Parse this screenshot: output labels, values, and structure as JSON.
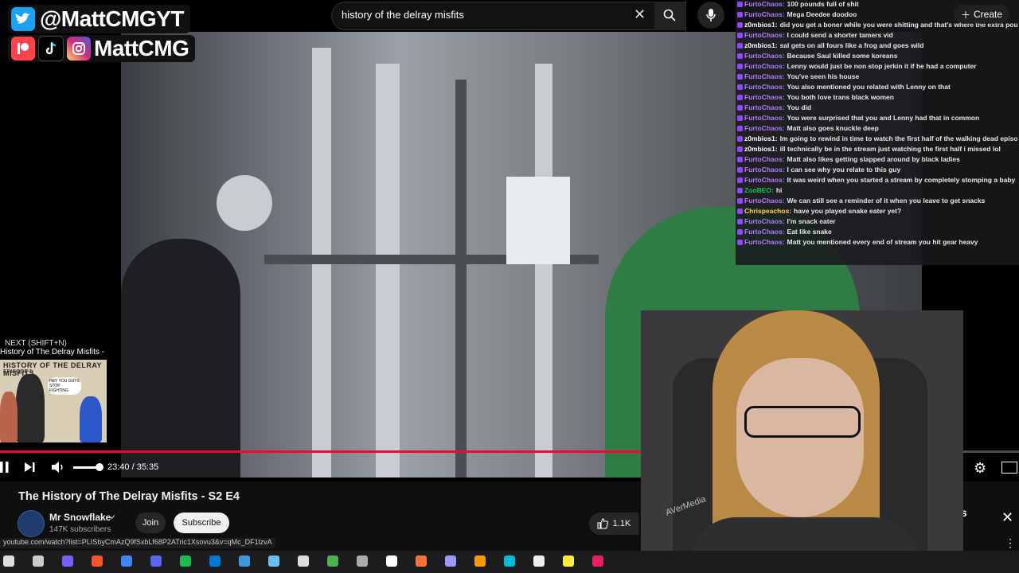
{
  "branding": {
    "twitter_handle": "@MattCMGYT",
    "social_handle": "MattCMG",
    "colors": {
      "twitter": "#1da1f2",
      "patreon": "#ff424d",
      "tiktok": "#000000",
      "instagram": "#d62976"
    }
  },
  "search": {
    "query": "history of the delray misfits"
  },
  "header": {
    "create_label": "Create"
  },
  "chat": [
    {
      "time": "",
      "user": "FurtoChaos",
      "user_color": "#b07bff",
      "text": "100 pounds full of shit"
    },
    {
      "time": "",
      "user": "FurtoChaos",
      "user_color": "#b07bff",
      "text": "Mega Deedee doodoo"
    },
    {
      "time": "",
      "user": "z0mbios1",
      "user_color": "#ffffff",
      "text": "did you get a boner while you were shitting and that's where the extra pounds came from"
    },
    {
      "time": "",
      "user": "FurtoChaos",
      "user_color": "#b07bff",
      "text": "I could send a shorter tamers vid"
    },
    {
      "time": "",
      "user": "z0mbios1",
      "user_color": "#ffffff",
      "text": "sal gets on all fours like a frog and goes wild"
    },
    {
      "time": "",
      "user": "FurtoChaos",
      "user_color": "#b07bff",
      "text": "Because Saul killed some koreans"
    },
    {
      "time": "",
      "user": "FurtoChaos",
      "user_color": "#b07bff",
      "text": "Lenny would just be non stop jerkin it if he had a computer"
    },
    {
      "time": "",
      "user": "FurtoChaos",
      "user_color": "#b07bff",
      "text": "You've seen his house"
    },
    {
      "time": "",
      "user": "FurtoChaos",
      "user_color": "#b07bff",
      "text": "You also mentioned you related with Lenny on that"
    },
    {
      "time": "",
      "user": "FurtoChaos",
      "user_color": "#b07bff",
      "text": "You both love trans black women"
    },
    {
      "time": "",
      "user": "FurtoChaos",
      "user_color": "#b07bff",
      "text": "You did"
    },
    {
      "time": "",
      "user": "FurtoChaos",
      "user_color": "#b07bff",
      "text": "You were surprised that you and Lenny had that in common"
    },
    {
      "time": "",
      "user": "FurtoChaos",
      "user_color": "#b07bff",
      "text": "Matt also goes knuckle deep"
    },
    {
      "time": "",
      "user": "z0mbios1",
      "user_color": "#ffffff",
      "text": "Im going to rewind in time to watch the first half of the walking dead episode, I'll see you in the future"
    },
    {
      "time": "",
      "user": "z0mbios1",
      "user_color": "#ffffff",
      "text": "ill technically be in the stream just watching the first half i missed lol"
    },
    {
      "time": "",
      "user": "FurtoChaos",
      "user_color": "#b07bff",
      "text": "Matt also likes getting slapped around by black ladies"
    },
    {
      "time": "",
      "user": "FurtoChaos",
      "user_color": "#b07bff",
      "text": "I can see why you relate to this guy"
    },
    {
      "time": "",
      "user": "FurtoChaos",
      "user_color": "#b07bff",
      "text": "It was weird when you started a stream by completely stomping a baby into your carpet , but now I understand why you did it"
    },
    {
      "time": "",
      "user": "ZooBEO",
      "user_color": "#00c853",
      "text": "hi"
    },
    {
      "time": "",
      "user": "FurtoChaos",
      "user_color": "#b07bff",
      "text": "We can still see a reminder of it when you leave to get snacks"
    },
    {
      "time": "",
      "user": "Chrispeachos",
      "user_color": "#ffd54f",
      "text": "have you played snake eater yet?"
    },
    {
      "time": "",
      "user": "FurtoChaos",
      "user_color": "#b07bff",
      "text": "I'm snack eater"
    },
    {
      "time": "",
      "user": "FurtoChaos",
      "user_color": "#b07bff",
      "text": "Eat like snake"
    },
    {
      "time": "",
      "user": "FurtoChaos",
      "user_color": "#b07bff",
      "text": "Matt you mentioned every end of stream you hit gear heavy"
    }
  ],
  "next_video": {
    "label": "NEXT (SHIFT+N)",
    "title": "History of The Delray Misfits - Season",
    "thumb_text": "HISTORY OF THE DELRAY MISFITS",
    "thumb_sub": "EPISODE 5",
    "thumb_bubble": "HEY YOU GUYS STOP FIGHTING"
  },
  "player": {
    "time_display": "23:40 / 35:35",
    "progress": 0.665,
    "volume": 0.8,
    "colors": {
      "progress": "#ff0033"
    }
  },
  "video": {
    "title": "The History of The Delray Misfits - S2 E4",
    "channel": "Mr Snowflake",
    "subscribers": "147K subscribers",
    "join_label": "Join",
    "subscribe_label": "Subscribe",
    "likes": "1.1K"
  },
  "status_url": "youtube.com/watch?list=PLISbyCmAzQ9fSxbLf68P2ATric1Xsovu3&v=qMc_DF1lzvA",
  "side_panel": {
    "title_fragment": "isfits"
  },
  "webcam": {
    "brand_text": "AVerMedia"
  },
  "taskbar": {
    "icons": [
      "start-icon",
      "taskview-icon",
      "copilot-icon",
      "brave-icon",
      "chrome-icon",
      "discord-icon",
      "spotify-icon",
      "edge-icon",
      "vscode-icon",
      "steam-icon",
      "epic-icon",
      "minecraft-icon",
      "app-icon",
      "obs-icon",
      "firefox-icon",
      "premiere-icon",
      "blender-icon",
      "tool-icon",
      "calculator-icon",
      "notes-icon",
      "game-icon"
    ],
    "colors": [
      "#dddddd",
      "#cccccc",
      "#7b5cff",
      "#fb542b",
      "#4285f4",
      "#5865f2",
      "#1db954",
      "#0078d4",
      "#3c99dc",
      "#66c0f4",
      "#dddddd",
      "#4caf50",
      "#aaaaaa",
      "#ffffff",
      "#ff7139",
      "#9999ff",
      "#ff9800",
      "#00bcd4",
      "#eeeeee",
      "#ffeb3b",
      "#e91e63"
    ]
  }
}
